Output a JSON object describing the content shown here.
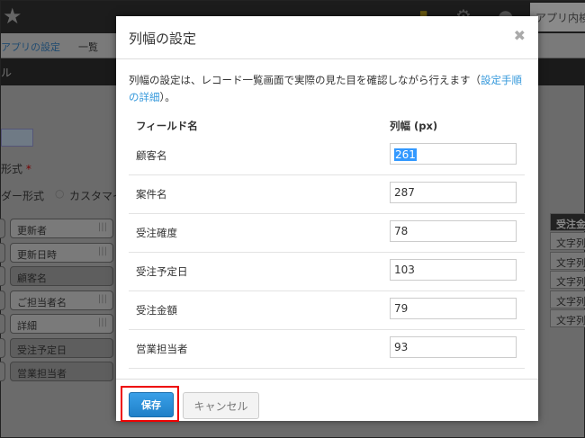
{
  "background": {
    "app_search": "アプリ内検索",
    "breadcrumb": [
      "アプリの設定",
      "一覧"
    ],
    "menu_fragment": "ル",
    "format_label": "形式",
    "required_mark": "*",
    "radio_options": [
      "ダー形式",
      "カスタマイズ"
    ],
    "field_pills": [
      {
        "label": "更新者",
        "placed": false
      },
      {
        "label": "更新日時",
        "placed": false
      },
      {
        "label": "顧客名",
        "placed": true
      },
      {
        "label": "ご担当者名",
        "placed": false
      },
      {
        "label": "詳細",
        "placed": false
      },
      {
        "label": "受注予定日",
        "placed": true
      },
      {
        "label": "営業担当者",
        "placed": true
      }
    ],
    "grid_header": "受注金額",
    "grid_cells": [
      "文字列",
      "文字列",
      "文字列",
      "文字列",
      "文字列"
    ]
  },
  "dialog": {
    "title": "列幅の設定",
    "close_icon": "close-icon",
    "description": "列幅の設定は、レコード一覧画面で実際の見た目を確認しながら行えます（",
    "link_text": "設定手順の詳細",
    "description_end": "）。",
    "col_field": "フィールド名",
    "col_width": "列幅 (px)",
    "rows": [
      {
        "field": "顧客名",
        "width": "261"
      },
      {
        "field": "案件名",
        "width": "287"
      },
      {
        "field": "受注確度",
        "width": "78"
      },
      {
        "field": "受注予定日",
        "width": "103"
      },
      {
        "field": "受注金額",
        "width": "79"
      },
      {
        "field": "営業担当者",
        "width": "93"
      }
    ],
    "save_label": "保存",
    "cancel_label": "キャンセル",
    "accent": "#3498db",
    "highlight": "#ee0000"
  }
}
